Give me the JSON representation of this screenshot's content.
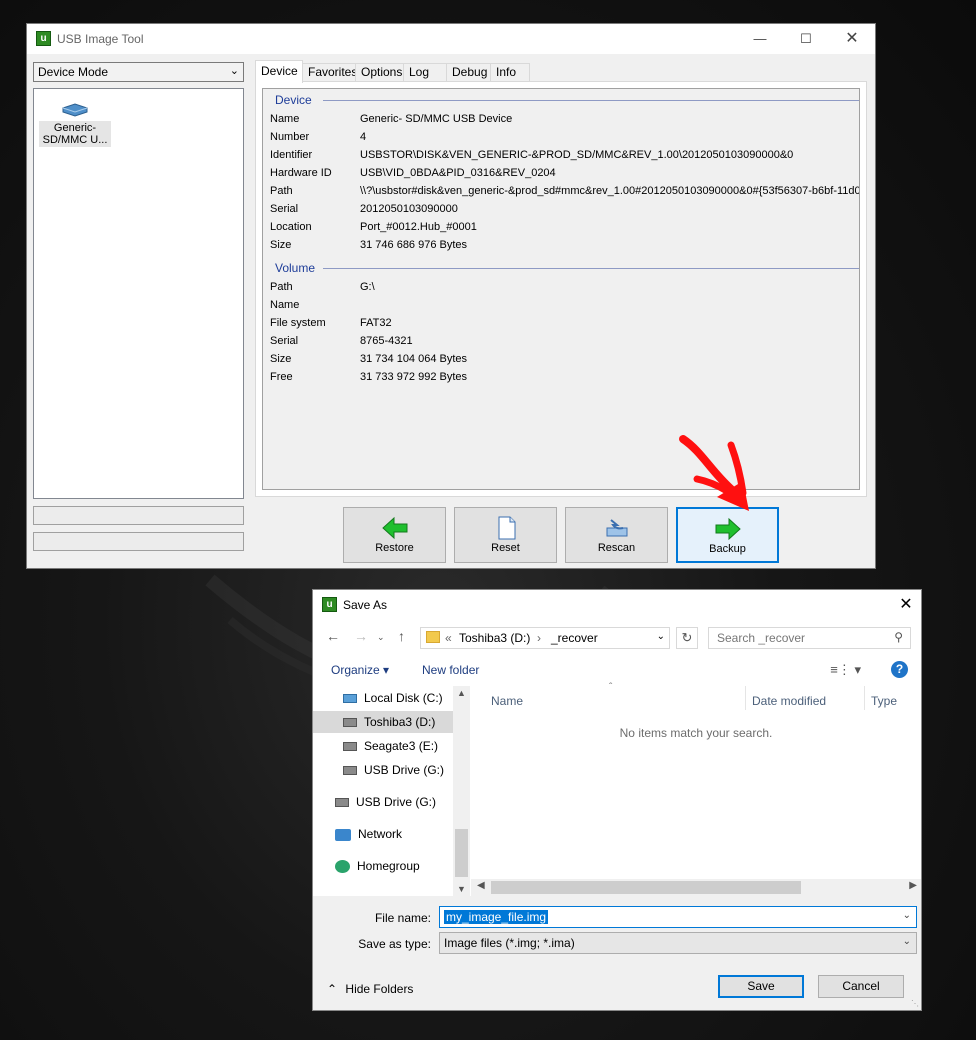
{
  "usb_tool": {
    "title": "USB Image Tool",
    "mode": "Device Mode",
    "device_item_label": "Generic-\nSD/MMC U...",
    "tabs": [
      "Device",
      "Favorites",
      "Options",
      "Log",
      "Debug",
      "Info"
    ],
    "device_group": "Device",
    "device_props": [
      {
        "k": "Name",
        "v": "Generic- SD/MMC USB Device"
      },
      {
        "k": "Number",
        "v": "4"
      },
      {
        "k": "Identifier",
        "v": "USBSTOR\\DISK&VEN_GENERIC-&PROD_SD/MMC&REV_1.00\\2012050103090000&0"
      },
      {
        "k": "Hardware ID",
        "v": "USB\\VID_0BDA&PID_0316&REV_0204"
      },
      {
        "k": "Path",
        "v": "\\\\?\\usbstor#disk&ven_generic-&prod_sd#mmc&rev_1.00#2012050103090000&0#{53f56307-b6bf-11d0"
      },
      {
        "k": "Serial",
        "v": "2012050103090000"
      },
      {
        "k": "Location",
        "v": "Port_#0012.Hub_#0001"
      },
      {
        "k": "Size",
        "v": "31 746 686 976 Bytes"
      }
    ],
    "volume_group": "Volume",
    "volume_props": [
      {
        "k": "Path",
        "v": "G:\\"
      },
      {
        "k": "Name",
        "v": ""
      },
      {
        "k": "File system",
        "v": "FAT32"
      },
      {
        "k": "Serial",
        "v": "8765-4321"
      },
      {
        "k": "Size",
        "v": "31 734 104 064 Bytes"
      },
      {
        "k": "Free",
        "v": "31 733 972 992 Bytes"
      }
    ],
    "buttons": {
      "restore": "Restore",
      "reset": "Reset",
      "rescan": "Rescan",
      "backup": "Backup"
    }
  },
  "save_as": {
    "title": "Save As",
    "breadcrumb": {
      "prefix": "«",
      "drive": "Toshiba3 (D:)",
      "sep": "›",
      "folder": "_recover"
    },
    "search_placeholder": "Search _recover",
    "organize": "Organize ▾",
    "new_folder": "New folder",
    "nav_items": [
      "Local Disk (C:)",
      "Toshiba3 (D:)",
      "Seagate3 (E:)",
      "USB Drive (G:)",
      "USB Drive (G:)",
      "Network",
      "Homegroup"
    ],
    "columns": [
      "Name",
      "Date modified",
      "Type"
    ],
    "empty_text": "No items match your search.",
    "file_name_label": "File name:",
    "file_name_value": "my_image_file.img",
    "save_type_label": "Save as type:",
    "save_type_value": "Image files (*.img; *.ima)",
    "hide_folders": "Hide Folders",
    "save": "Save",
    "cancel": "Cancel"
  },
  "colors": {
    "accent": "#0078d7",
    "group_text": "#1e3d99",
    "arrow_green": "#1fbf2e",
    "red_arrow": "#ff1010"
  }
}
